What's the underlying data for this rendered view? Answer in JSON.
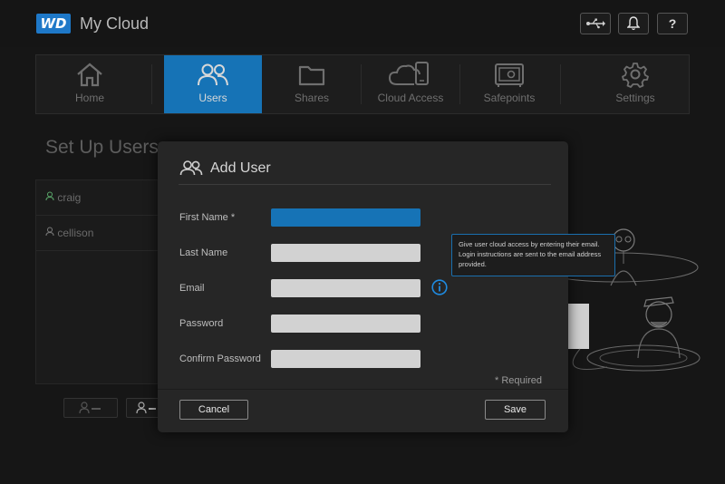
{
  "app": {
    "logo": "WD",
    "title": "My Cloud"
  },
  "header_buttons": [
    {
      "name": "usb-icon",
      "glyph": "⭍"
    },
    {
      "name": "notifications-bell-icon",
      "glyph": ""
    },
    {
      "name": "help-icon",
      "glyph": "?"
    }
  ],
  "nav": {
    "items": [
      {
        "label": "Home",
        "icon": "home-icon",
        "active": false
      },
      {
        "label": "Users",
        "icon": "users-icon",
        "active": true
      },
      {
        "label": "Shares",
        "icon": "folder-icon",
        "active": false
      },
      {
        "label": "Cloud Access",
        "icon": "cloud-access-icon",
        "active": false
      },
      {
        "label": "Safepoints",
        "icon": "safe-icon",
        "active": false
      },
      {
        "label": "Settings",
        "icon": "gear-icon",
        "active": false
      }
    ]
  },
  "page": {
    "title": "Set Up Users",
    "users": [
      "craig",
      "cellison"
    ]
  },
  "modal": {
    "title": "Add User",
    "fields": [
      {
        "label": "First Name *",
        "value": "",
        "focused": true
      },
      {
        "label": "Last Name",
        "value": ""
      },
      {
        "label": "Email",
        "value": ""
      },
      {
        "label": "Password",
        "value": ""
      },
      {
        "label": "Confirm Password",
        "value": ""
      }
    ],
    "required_note": "* Required",
    "cancel_label": "Cancel",
    "save_label": "Save"
  },
  "tooltip": {
    "text": "Give user cloud access by entering their email. Login instructions are sent to the email address provided."
  },
  "colors": {
    "accent": "#1673b6",
    "background": "#161616",
    "modal": "#262626"
  }
}
